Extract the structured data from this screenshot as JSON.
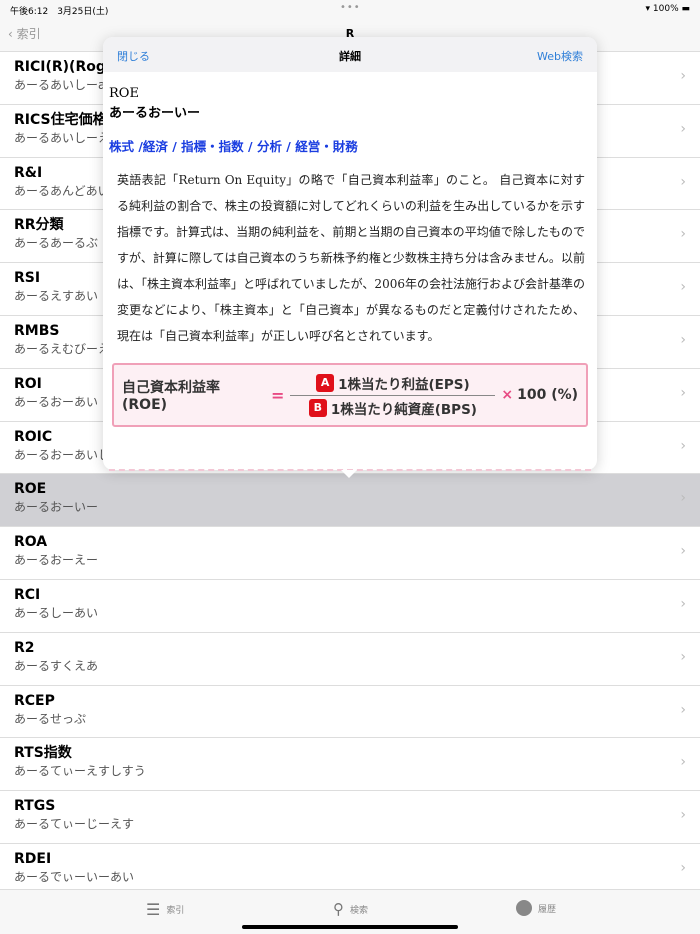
{
  "status": {
    "time": "午後6:12　3月25日(土)",
    "dots": "•••",
    "battery": "100%"
  },
  "nav": {
    "back": "索引",
    "title": "R"
  },
  "rows": [
    {
      "title": "RICI(R)(Roger",
      "reading": "あーるあいしーa"
    },
    {
      "title": "RICS住宅価格",
      "reading": "あーるあいしーえ"
    },
    {
      "title": "R&I",
      "reading": "あーるあんどあい"
    },
    {
      "title": "RR分類",
      "reading": "あーるあーるぶ"
    },
    {
      "title": "RSI",
      "reading": "あーるえすあい"
    },
    {
      "title": "RMBS",
      "reading": "あーるえむびーえ"
    },
    {
      "title": "ROI",
      "reading": "あーるおーあい"
    },
    {
      "title": "ROIC",
      "reading": "あーるおーあいし"
    },
    {
      "title": "ROE",
      "reading": "あーるおーいー"
    },
    {
      "title": "ROA",
      "reading": "あーるおーえー"
    },
    {
      "title": "RCI",
      "reading": "あーるしーあい"
    },
    {
      "title": "R2",
      "reading": "あーるすくえあ"
    },
    {
      "title": "RCEP",
      "reading": "あーるせっぷ"
    },
    {
      "title": "RTS指数",
      "reading": "あーるてぃーえすしすう"
    },
    {
      "title": "RTGS",
      "reading": "あーるてぃーじーえす"
    },
    {
      "title": "RDEI",
      "reading": "あーるでぃーいーあい"
    }
  ],
  "popup": {
    "close": "閉じる",
    "title": "詳細",
    "web": "Web検索",
    "term": "ROE",
    "reading": "あーるおーいー",
    "categories": "株式 /経済 / 指標・指数 / 分析 / 経営・財務",
    "description": "英語表記「Return On Equity」の略で「自己資本利益率」のこと。 自己資本に対する純利益の割合で、株主の投資額に対してどれくらいの利益を生み出しているかを示す指標です。計算式は、当期の純利益を、前期と当期の自己資本の平均値で除したものですが、計算に際しては自己資本のうち新株予約権と少数株主持ち分は含みません。以前は、「株主資本利益率」と呼ばれていましたが、2006年の会社法施行および会計基準の変更などにより、「株主資本」と「自己資本」が異なるものだと定義付けされたため、現在は「自己資本利益率」が正しい呼び名とされています。",
    "formula": {
      "lhs": "自己資本利益率(ROE)",
      "eq": "=",
      "a": "A",
      "num": "1株当たり利益(EPS)",
      "b": "B",
      "den": "1株当たり純資産(BPS)",
      "times": "×",
      "rhs": "100 (%)"
    }
  },
  "tabs": {
    "index": "索引",
    "search": "検索",
    "history": "履歴"
  }
}
